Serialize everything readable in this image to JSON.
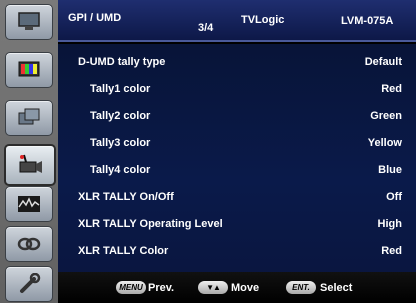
{
  "header": {
    "title": "GPI / UMD",
    "page": "3/4",
    "brand": "TVLogic",
    "model": "LVM-075A"
  },
  "settings": [
    {
      "label": "D-UMD tally type",
      "value": "Default"
    },
    {
      "label": "Tally1 color",
      "value": "Red"
    },
    {
      "label": "Tally2 color",
      "value": "Green"
    },
    {
      "label": "Tally3 color",
      "value": "Yellow"
    },
    {
      "label": "Tally4 color",
      "value": "Blue"
    },
    {
      "label": "XLR TALLY On/Off",
      "value": "Off"
    },
    {
      "label": "XLR TALLY Operating Level",
      "value": "High"
    },
    {
      "label": "XLR TALLY Color",
      "value": "Red"
    }
  ],
  "footer": {
    "prev_key": "MENU",
    "prev_label": "Prev.",
    "move_key": "▼▲",
    "move_label": "Move",
    "select_key": "ENT.",
    "select_label": "Select"
  },
  "sidebar": {
    "icons": [
      "monitor-icon",
      "color-bars-icon",
      "screens-icon",
      "camera-tally-icon",
      "video-waveform-icon",
      "link-icon",
      "wrench-icon"
    ],
    "active_index": 3
  }
}
